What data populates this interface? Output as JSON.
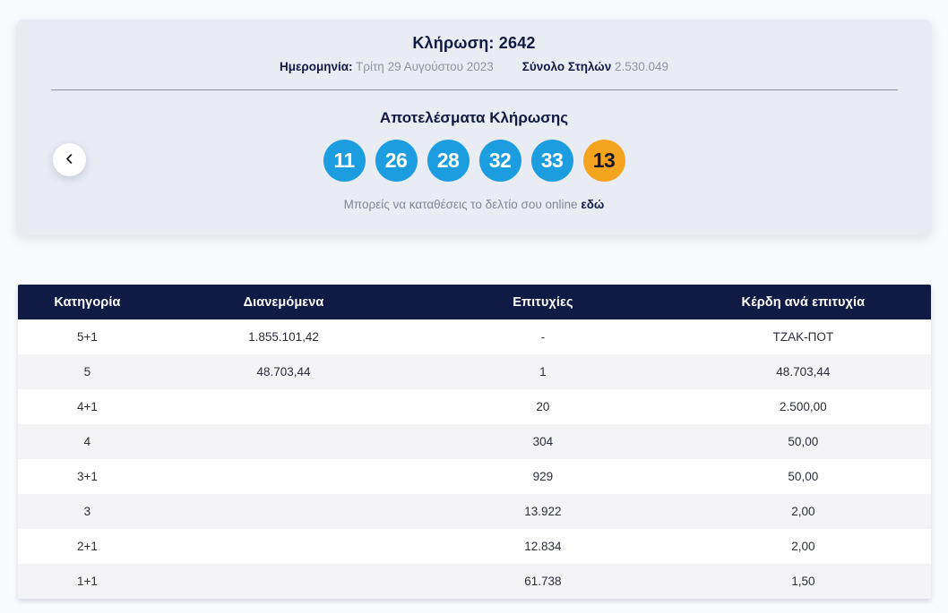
{
  "colors": {
    "navy": "#101b45",
    "ball_blue": "#1c9de0",
    "ball_orange": "#f5a41f",
    "muted_text": "#8d94a5",
    "row_alt": "#f4f4f6",
    "card_bg": "#e9ecf3"
  },
  "draw": {
    "title": "Κλήρωση: 2642",
    "date_label": "Ημερομηνία:",
    "date_value": "Τρίτη 29 Αυγούστου 2023",
    "total_columns_label": "Σύνολο Στηλών",
    "total_columns_value": "2.530.049",
    "results_heading": "Αποτελέσματα Κλήρωσης",
    "numbers": [
      "11",
      "26",
      "28",
      "32",
      "33"
    ],
    "joker_number": "13",
    "cta_text": "Μπορείς να καταθέσεις το δελτίο σου online",
    "cta_link_label": "εδώ"
  },
  "results_table": {
    "headers": [
      "Κατηγορία",
      "Διανεμόμενα",
      "Επιτυχίες",
      "Κέρδη ανά επιτυχία"
    ],
    "rows": [
      {
        "category": "5+1",
        "distributed": "1.855.101,42",
        "winners": "-",
        "prize_per_winner": "ΤΖΑΚ-ΠΟΤ"
      },
      {
        "category": "5",
        "distributed": "48.703,44",
        "winners": "1",
        "prize_per_winner": "48.703,44"
      },
      {
        "category": "4+1",
        "distributed": "",
        "winners": "20",
        "prize_per_winner": "2.500,00"
      },
      {
        "category": "4",
        "distributed": "",
        "winners": "304",
        "prize_per_winner": "50,00"
      },
      {
        "category": "3+1",
        "distributed": "",
        "winners": "929",
        "prize_per_winner": "50,00"
      },
      {
        "category": "3",
        "distributed": "",
        "winners": "13.922",
        "prize_per_winner": "2,00"
      },
      {
        "category": "2+1",
        "distributed": "",
        "winners": "12.834",
        "prize_per_winner": "2,00"
      },
      {
        "category": "1+1",
        "distributed": "",
        "winners": "61.738",
        "prize_per_winner": "1,50"
      }
    ]
  }
}
